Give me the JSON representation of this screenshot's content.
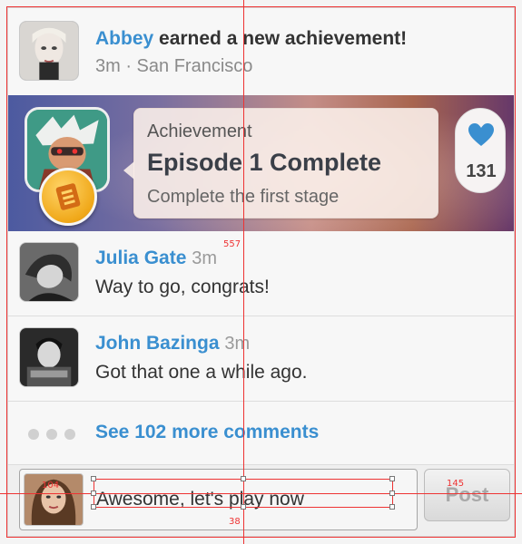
{
  "header": {
    "user_name": "Abbey",
    "action_text": " earned a new achievement!",
    "meta": "3m · San Francisco"
  },
  "achievement": {
    "label": "Achievement",
    "title": "Episode 1 Complete",
    "description": "Complete the first stage",
    "like_count": "131"
  },
  "comments": [
    {
      "name": "Julia Gate",
      "time": "3m",
      "text": "Way to go, congrats!"
    },
    {
      "name": "John Bazinga",
      "time": "3m",
      "text": "Got that one a while ago."
    }
  ],
  "more_comments": "See 102 more comments",
  "composer": {
    "input_value": "Awesome, let's play now",
    "post_label": "Post"
  },
  "measurements": {
    "vertical_label": "557",
    "left_label": "104",
    "right_label": "145",
    "height_label": "38"
  },
  "colors": {
    "accent": "#3a8fd0",
    "guide": "#e33333",
    "heart": "#3a8fd0",
    "badge": "#f0a819"
  },
  "icons": [
    "heart-icon",
    "badge-icon",
    "ellipsis-icon"
  ]
}
